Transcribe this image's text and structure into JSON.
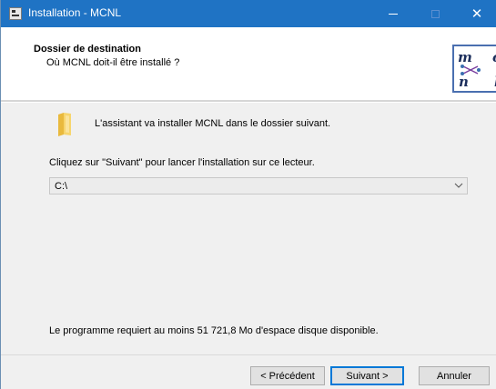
{
  "window": {
    "title": "Installation - MCNL"
  },
  "header": {
    "title": "Dossier de destination",
    "subtitle": "Où MCNL doit-il être installé ?",
    "logo_letters": [
      "m",
      "c",
      "n",
      "l"
    ]
  },
  "body": {
    "intro": "L'assistant va installer MCNL dans le dossier suivant.",
    "instruction": "Cliquez sur \"Suivant\" pour lancer l'installation sur ce lecteur.",
    "destination": "C:\\",
    "space_info": "Le programme requiert au moins 51 721,8 Mo d'espace disque disponible."
  },
  "buttons": {
    "back": "< Précédent",
    "next": "Suivant >",
    "cancel": "Annuler"
  },
  "colors": {
    "titlebar": "#1f73c4",
    "accent": "#0078d7",
    "logo_border": "#4a6fb0"
  },
  "icons": {
    "app": "installer-app-icon",
    "folder": "folder-icon",
    "dropdown": "chevron-down-icon"
  }
}
